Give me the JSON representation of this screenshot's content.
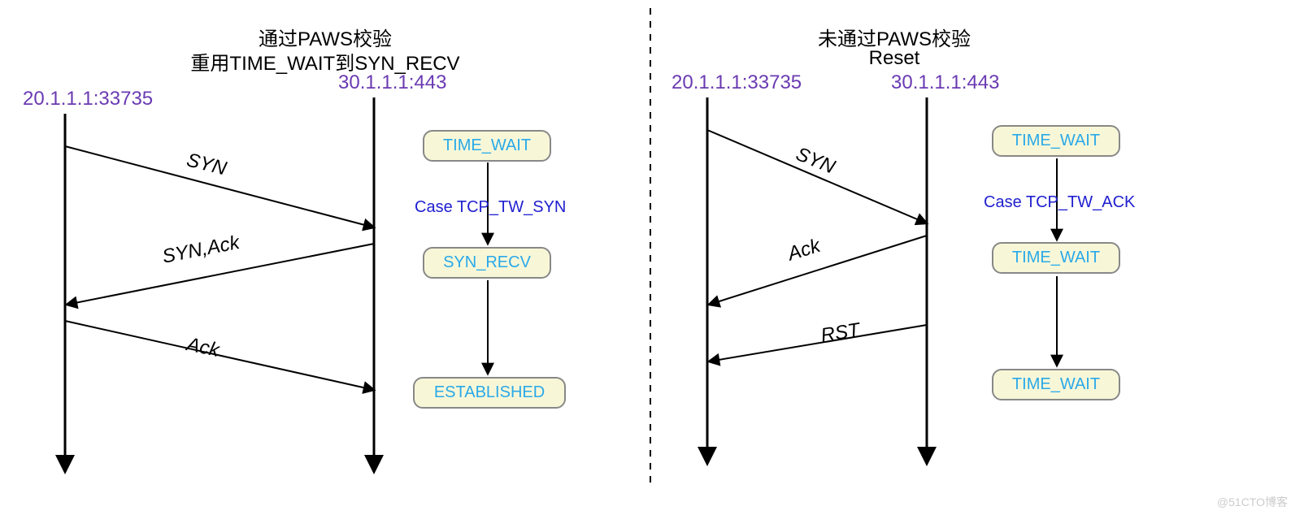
{
  "left": {
    "title_line1": "通过PAWS校验",
    "title_line2": "重用TIME_WAIT到SYN_RECV",
    "client": "20.1.1.1:33735",
    "server": "30.1.1.1:443",
    "states": [
      "TIME_WAIT",
      "SYN_RECV",
      "ESTABLISHED"
    ],
    "case_label": "Case TCP_TW_SYN",
    "messages": [
      "SYN",
      "SYN,Ack",
      "Ack"
    ]
  },
  "right": {
    "title_line1": "未通过PAWS校验",
    "title_line2": "Reset",
    "client": "20.1.1.1:33735",
    "server": "30.1.1.1:443",
    "states": [
      "TIME_WAIT",
      "TIME_WAIT",
      "TIME_WAIT"
    ],
    "case_label": "Case TCP_TW_ACK",
    "messages": [
      "SYN",
      "Ack",
      "RST"
    ]
  },
  "watermark": "@51CTO博客"
}
